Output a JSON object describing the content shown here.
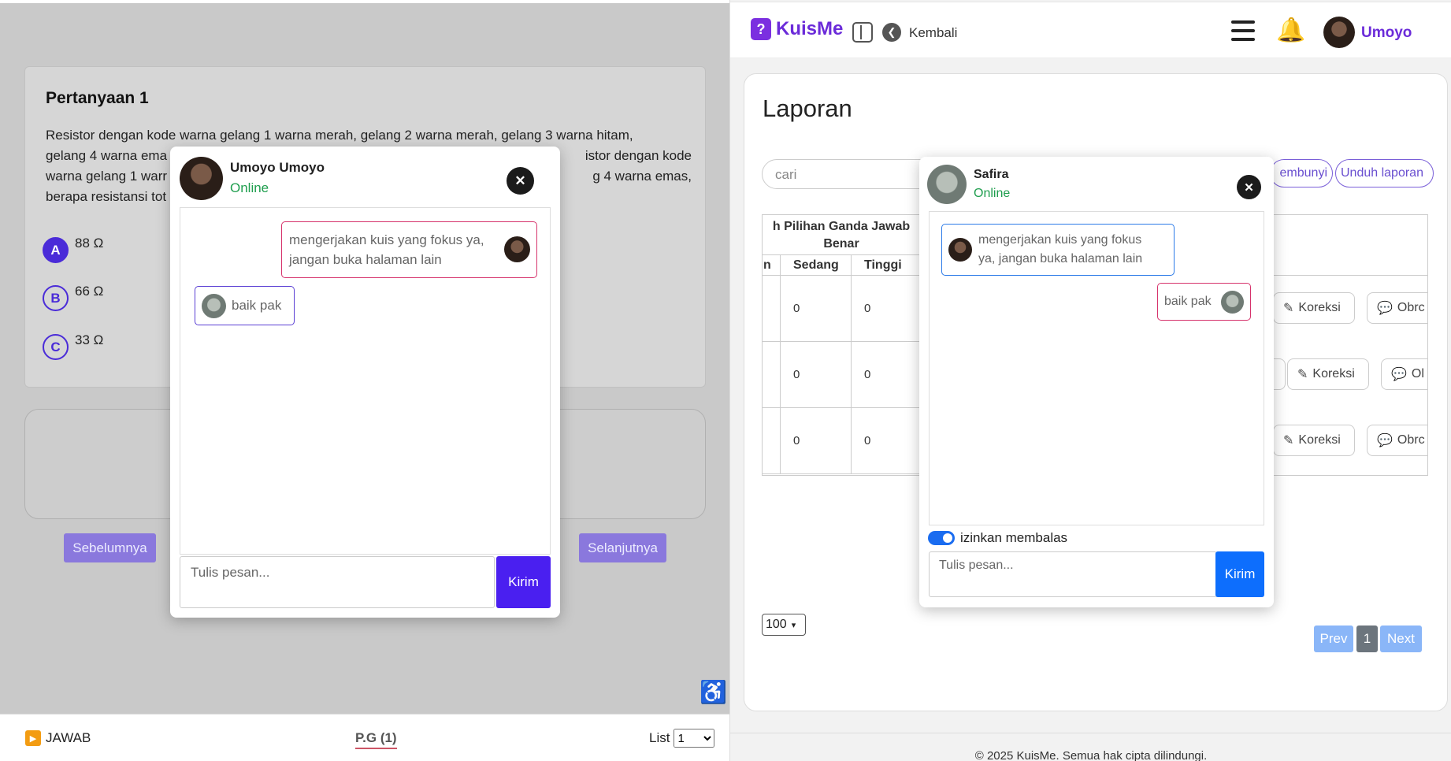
{
  "left": {
    "question_title": "Pertanyaan 1",
    "question_text": "Resistor dengan kode warna gelang 1 warna merah, gelang 2 warna merah, gelang 3 warna hitam, gelang 4 warna ema                                                                                              istor dengan kode warna gelang 1 warr                                                                                              g 4 warna emas, berapa resistansi tot",
    "q_line1": "Resistor dengan kode warna gelang 1 warna merah, gelang 2 warna merah, gelang 3 warna hitam,",
    "q_line2a": "gelang 4 warna ema",
    "q_line2b": "istor dengan kode",
    "q_line3a": "warna gelang 1 warr",
    "q_line3b": "g 4 warna emas,",
    "q_line4a": "berapa resistansi tot",
    "options": [
      {
        "letter": "A",
        "text": "88 Ω"
      },
      {
        "letter": "B",
        "text": "66 Ω"
      },
      {
        "letter": "C",
        "text": "33 Ω"
      }
    ],
    "prev_label": "Sebelumnya",
    "next_label": "Selanjutnya",
    "accessibility_icon": "♿",
    "footer": {
      "jawab": "JAWAB",
      "pg": "P.G (1)",
      "list_label": "List",
      "list_value": "1"
    }
  },
  "chat_left": {
    "name": "Umoyo Umoyo",
    "status": "Online",
    "close": "✕",
    "msg1": "mengerjakan kuis yang fokus ya, jangan buka halaman lain",
    "msg1_l1": "mengerjakan kuis yang fokus ya,",
    "msg1_l2": "jangan buka halaman lain",
    "msg2": "baik pak",
    "placeholder": "Tulis pesan...",
    "send": "Kirim"
  },
  "right": {
    "brand": "KuisMe",
    "back": "Kembali",
    "user": "Umoyo",
    "title": "Laporan",
    "search_placeholder": "cari",
    "btn_hide": "embunyi",
    "btn_download": "Unduh laporan",
    "table_header": "h Pilihan Ganda Jawab Benar",
    "th_l1": "h Pilihan Ganda Jawab",
    "th_l2": "Benar",
    "sub_h0": "n",
    "sub_h1": "Sedang",
    "sub_h2": "Tinggi",
    "rows": [
      {
        "sedang": "0",
        "tinggi": "0"
      },
      {
        "sedang": "0",
        "tinggi": "0"
      },
      {
        "sedang": "0",
        "tinggi": "0"
      }
    ],
    "btn_koreksi": "Koreksi",
    "btn_obrolan_r1": "Obrc",
    "btn_obrolan_r2": "Ol",
    "btn_obrolan_r3": "Obrc",
    "page_size": "100",
    "prev": "Prev",
    "page": "1",
    "next": "Next",
    "footer": "© 2025 KuisMe. Semua hak cipta dilindungi."
  },
  "chat_right": {
    "name": "Safira",
    "status": "Online",
    "close": "✕",
    "msg1_l1": "mengerjakan kuis yang fokus",
    "msg1_l2": "ya, jangan buka halaman lain",
    "msg2": "baik pak",
    "toggle_label": "izinkan membalas",
    "placeholder": "Tulis pesan...",
    "send": "Kirim"
  },
  "colors": {
    "accent": "#4a2bd8",
    "brand": "#6b2bd9",
    "send_left": "#4a1ff0",
    "send_right": "#0d6efd",
    "online": "#1f9e4e"
  }
}
